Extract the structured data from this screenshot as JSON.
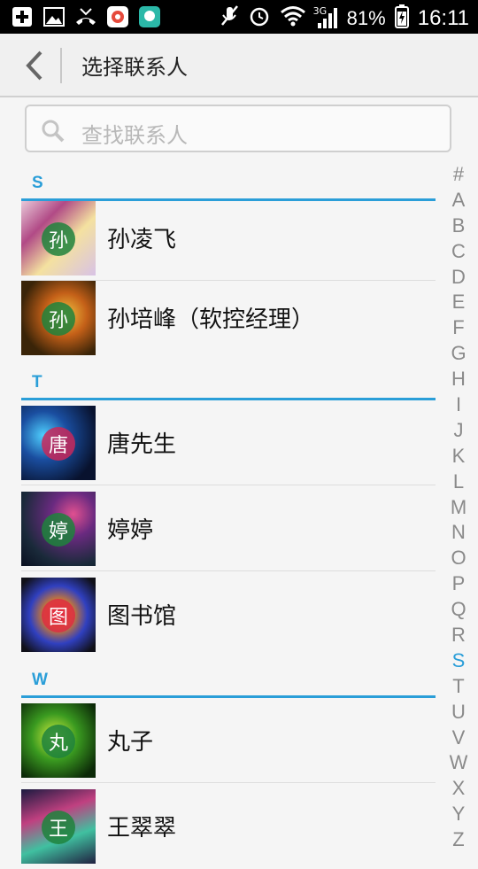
{
  "status_bar": {
    "network": "3G",
    "battery": "81%",
    "time": "16:11",
    "left_icons": [
      "plus-square-icon",
      "image-icon",
      "missed-call-icon",
      "app-store-icon",
      "huawei-icon"
    ],
    "right_icons": [
      "mute-icon",
      "alarm-icon",
      "wifi-icon",
      "signal-icon",
      "battery-charging-icon"
    ]
  },
  "app_bar": {
    "title": "选择联系人"
  },
  "search": {
    "placeholder": "查找联系人"
  },
  "sections": [
    {
      "letter": "S",
      "contacts": [
        {
          "name": "孙凌飞",
          "avatar_char": "孙"
        },
        {
          "name": "孙培峰（软控经理）",
          "avatar_char": "孙"
        }
      ]
    },
    {
      "letter": "T",
      "contacts": [
        {
          "name": "唐先生",
          "avatar_char": "唐"
        },
        {
          "name": "婷婷",
          "avatar_char": "婷"
        },
        {
          "name": "图书馆",
          "avatar_char": "图"
        }
      ]
    },
    {
      "letter": "W",
      "contacts": [
        {
          "name": "丸子",
          "avatar_char": "丸"
        },
        {
          "name": "王翠翠",
          "avatar_char": "王"
        }
      ]
    }
  ],
  "index_bar": [
    "#",
    "A",
    "B",
    "C",
    "D",
    "E",
    "F",
    "G",
    "H",
    "I",
    "J",
    "K",
    "L",
    "M",
    "N",
    "O",
    "P",
    "Q",
    "R",
    "S",
    "T",
    "U",
    "V",
    "W",
    "X",
    "Y",
    "Z"
  ],
  "index_active": "S",
  "colors": {
    "accent": "#2a9ed8"
  }
}
